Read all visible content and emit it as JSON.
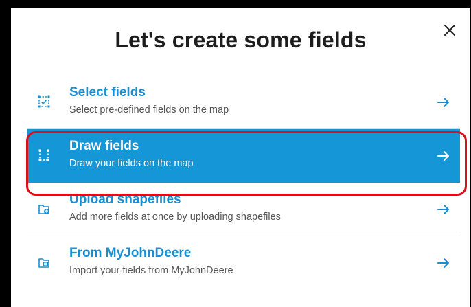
{
  "dialog": {
    "title": "Let's create some fields",
    "close_icon": "close-icon"
  },
  "options": [
    {
      "label": "Select fields",
      "description": "Select pre-defined fields on the map",
      "icon": "select-area-icon",
      "selected": false
    },
    {
      "label": "Draw fields",
      "description": "Draw your fields on the map",
      "icon": "draw-corners-icon",
      "selected": true
    },
    {
      "label": "Upload shapefiles",
      "description": "Add more fields at once by uploading shapefiles",
      "icon": "upload-file-icon",
      "selected": false
    },
    {
      "label": "From MyJohnDeere",
      "description": "Import your fields from MyJohnDeere",
      "icon": "import-file-icon",
      "selected": false
    }
  ],
  "colors": {
    "accent": "#1a8ed1",
    "selected_background": "#1596d6",
    "highlight_outline": "#d8101a"
  }
}
